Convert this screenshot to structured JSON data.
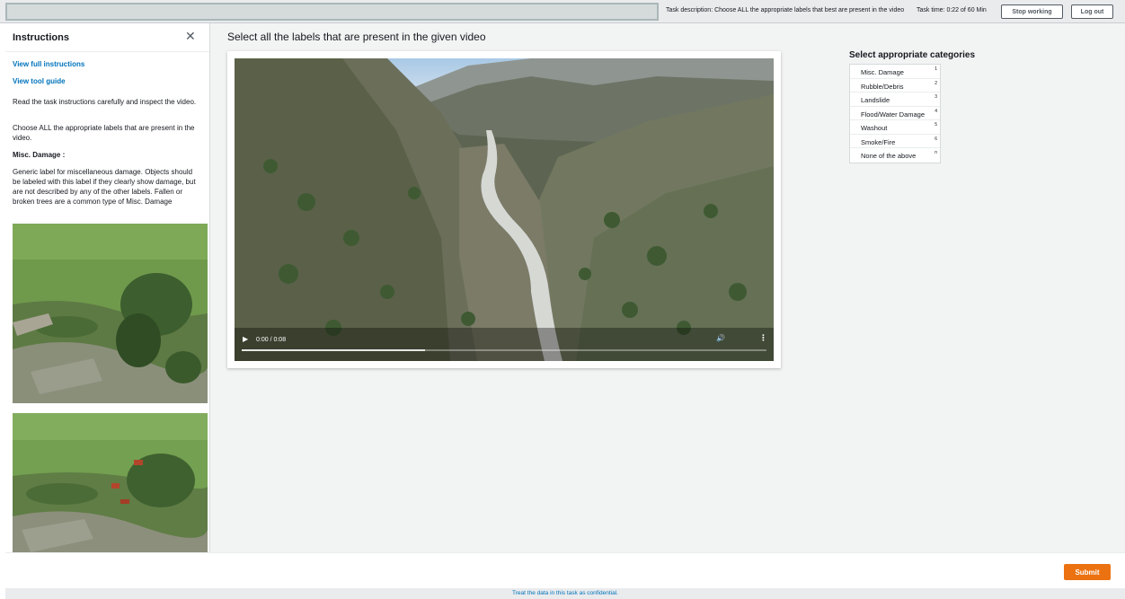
{
  "topbar": {
    "task_description": "Task description: Choose ALL the appropriate labels that best are present in the video",
    "task_time": "Task time: 0:22 of 60 Min",
    "stop_working_label": "Stop working",
    "log_out_label": "Log out"
  },
  "sidebar": {
    "title": "Instructions",
    "close_icon": "close-icon",
    "view_full_instructions": "View full instructions",
    "view_tool_guide": "View tool guide",
    "para1": "Read the task instructions carefully and inspect the video.",
    "para2": "Choose ALL the appropriate labels that are present in the video.",
    "label_heading": "Misc. Damage :",
    "label_description": "Generic label for miscellaneous damage. Objects should be labeled with this label if they clearly show damage, but are not described by any of the other labels. Fallen or broken trees are a common type of Misc. Damage"
  },
  "main": {
    "title": "Select all the labels that are present in the given video",
    "video": {
      "time": "0:00 / 0:08",
      "progress": 0.35,
      "controls": [
        "play-icon",
        "volume-icon",
        "more-options-icon"
      ]
    },
    "categories": {
      "title": "Select appropriate categories",
      "items": [
        {
          "label": "Misc. Damage",
          "key": "1"
        },
        {
          "label": "Rubble/Debris",
          "key": "2"
        },
        {
          "label": "Landslide",
          "key": "3"
        },
        {
          "label": "Flood/Water Damage",
          "key": "4"
        },
        {
          "label": "Washout",
          "key": "5"
        },
        {
          "label": "Smoke/Fire",
          "key": "6"
        },
        {
          "label": "None of the above",
          "key": "n"
        }
      ]
    }
  },
  "footer": {
    "submit_label": "Submit",
    "confidential": "Treat the data in this task as confidential."
  },
  "colors": {
    "link": "#0073bb",
    "submit": "#ec7211",
    "background": "#f2f3f3"
  }
}
